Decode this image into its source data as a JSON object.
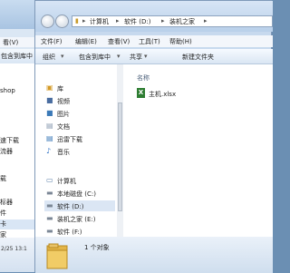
{
  "back_window": {
    "menu": "看(V)",
    "command": "包含到库中",
    "items": [
      "shop",
      "速下载",
      "流器",
      "载",
      "",
      "",
      "",
      "标器",
      "件",
      "卡",
      "家"
    ],
    "status_date": "2/25 13:1"
  },
  "address": {
    "segments": [
      "计算机",
      "软件 (D:)",
      "装机之家"
    ]
  },
  "menu": [
    "文件(F)",
    "编辑(E)",
    "查看(V)",
    "工具(T)",
    "帮助(H)"
  ],
  "toolbar": [
    "组织",
    "包含到库中",
    "共享",
    "新建文件夹"
  ],
  "nav": {
    "library": "库",
    "library_items": [
      "视频",
      "图片",
      "文档",
      "迅雷下载",
      "音乐"
    ],
    "computer": "计算机",
    "drives": [
      "本地磁盘 (C:)",
      "软件 (D:)",
      "装机之家 (E:)",
      "软件 (F:)"
    ]
  },
  "files": {
    "column_header": "名称",
    "items": [
      "主机.xlsx"
    ]
  },
  "status": {
    "count_text": "1 个对象"
  }
}
